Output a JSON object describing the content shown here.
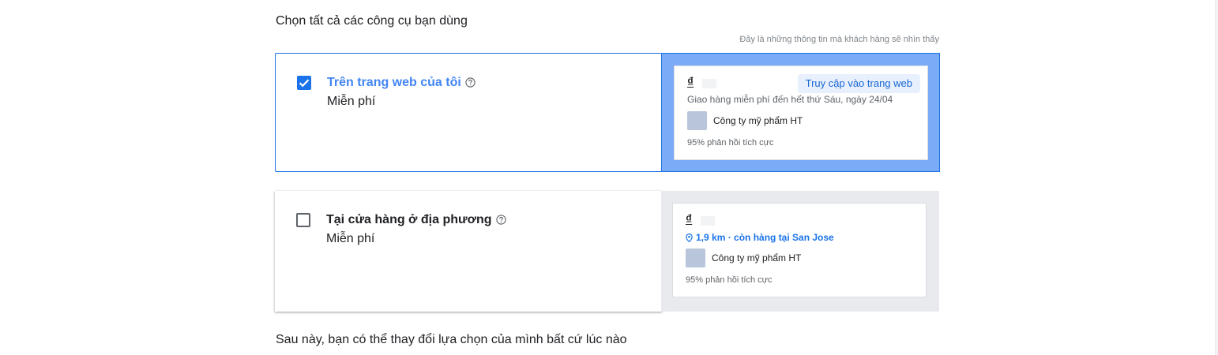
{
  "page": {
    "heading": "Chọn tất cả các công cụ bạn dùng",
    "preview_hint": "Đây là những thông tin mà khách hàng sẽ nhìn thấy",
    "footer_note": "Sau này, bạn có thể thay đổi lựa chọn của mình bất cứ lúc nào"
  },
  "options": [
    {
      "title": "Trên trang web của tôi",
      "price": "Miễn phí",
      "checked": true,
      "help_icon": "help-circle-icon",
      "preview": {
        "currency": "₫",
        "visit_button": "Truy cập vào trang web",
        "shipping": "Giao hàng miễn phí đến hết thứ Sáu, ngày 24/04",
        "merchant": "Công ty mỹ phẩm HT",
        "rating": "95% phản hồi tích cực"
      }
    },
    {
      "title": "Tại cửa hàng ở địa phương",
      "price": "Miễn phí",
      "checked": false,
      "help_icon": "help-circle-icon",
      "preview": {
        "currency": "₫",
        "location": "1,9 km · còn hàng tại San Jose",
        "location_icon": "location-pin-icon",
        "merchant": "Công ty mỹ phẩm HT",
        "rating": "95% phản hồi tích cực"
      }
    }
  ],
  "colors": {
    "accent": "#1a73e8",
    "selected_preview_bg": "#7baaf7",
    "unselected_preview_bg": "#e8eaed",
    "merchant_logo_placeholder": "#b8c5db"
  }
}
